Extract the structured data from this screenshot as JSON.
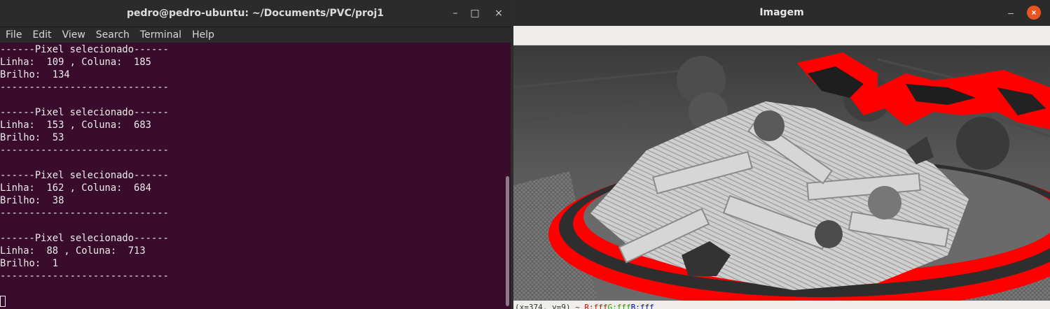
{
  "terminal": {
    "title": "pedro@pedro-ubuntu: ~/Documents/PVC/proj1",
    "window_controls": {
      "minimize": "–",
      "maximize": "□",
      "close": "×"
    },
    "menu": [
      "File",
      "Edit",
      "View",
      "Search",
      "Terminal",
      "Help"
    ],
    "lines": [
      "------Pixel selecionado------",
      "Linha:  109 , Coluna:  185",
      "Brilho:  134",
      "-----------------------------",
      "",
      "------Pixel selecionado------",
      "Linha:  153 , Coluna:  683",
      "Brilho:  53",
      "-----------------------------",
      "",
      "------Pixel selecionado------",
      "Linha:  162 , Coluna:  684",
      "Brilho:  38",
      "-----------------------------",
      "",
      "------Pixel selecionado------",
      "Linha:  88 , Coluna:  713",
      "Brilho:  1",
      "-----------------------------"
    ]
  },
  "image_window": {
    "title": "Imagem",
    "window_controls": {
      "minimize": "–",
      "close": "×"
    },
    "image_subject": "grayscale photo of penne pasta on a plate with red highlighted pixel regions",
    "highlight_color": "#ff0000",
    "status": {
      "coords": "(x=374, y=9) ~",
      "r": "R:fff",
      "g": "G:fff",
      "b": "B:fff"
    }
  }
}
